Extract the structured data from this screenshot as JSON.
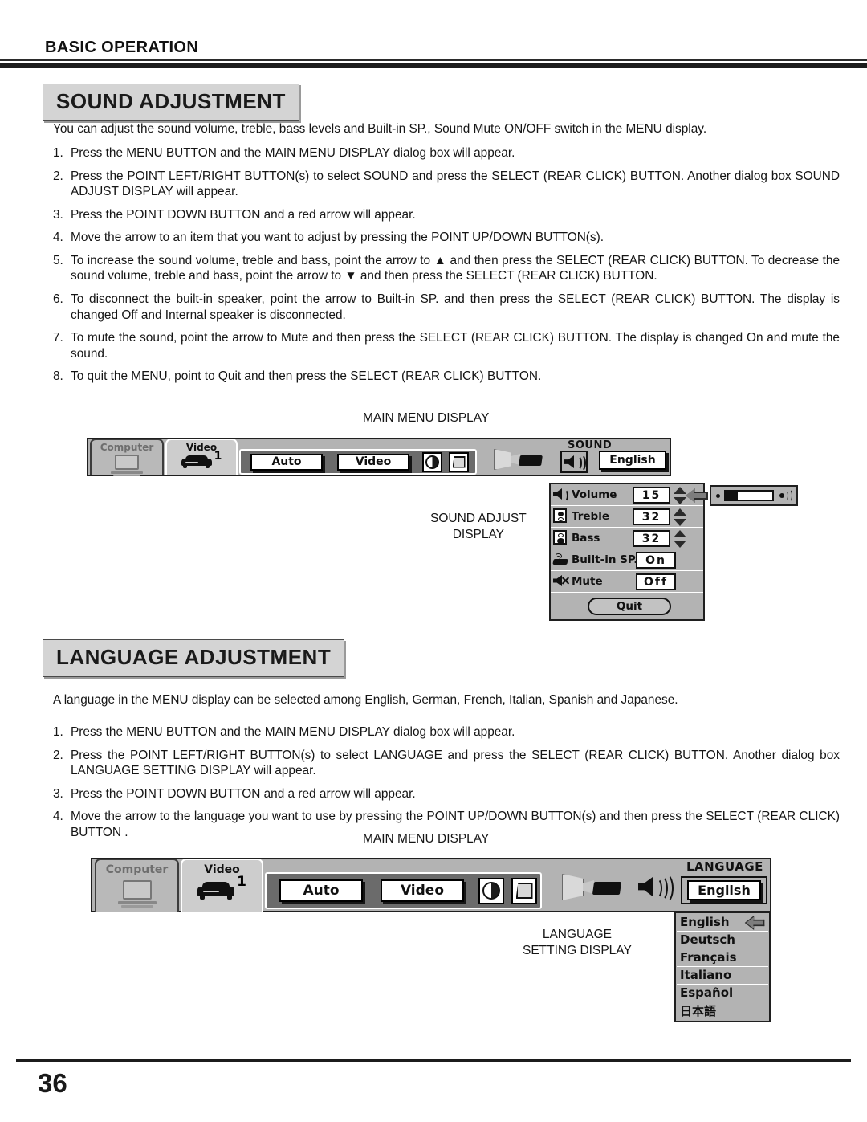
{
  "header": {
    "title": "BASIC OPERATION"
  },
  "footer": {
    "page_number": "36"
  },
  "sound_section": {
    "title": "SOUND ADJUSTMENT",
    "intro": "You can adjust the sound volume, treble, bass levels and Built-in SP., Sound Mute ON/OFF switch in the MENU display.",
    "steps": [
      {
        "num": "1.",
        "text": "Press the MENU BUTTON and the MAIN MENU DISPLAY dialog box will appear."
      },
      {
        "num": "2.",
        "text": "Press the POINT LEFT/RIGHT BUTTON(s) to select SOUND and press the SELECT (REAR CLICK) BUTTON. Another dialog box SOUND ADJUST DISPLAY will appear."
      },
      {
        "num": "3.",
        "text": "Press the POINT DOWN BUTTON and a red arrow will appear."
      },
      {
        "num": "4.",
        "text": "Move the arrow to an item that you want to adjust by pressing the POINT UP/DOWN BUTTON(s)."
      },
      {
        "num": "5.",
        "text": "To increase the sound volume, treble and bass, point the arrow to ▲ and then press the SELECT (REAR CLICK) BUTTON. To decrease the sound volume, treble and bass, point the arrow to ▼ and then press the SELECT (REAR CLICK) BUTTON."
      },
      {
        "num": "6.",
        "text": "To disconnect the built-in speaker, point the arrow to Built-in SP. and then press the SELECT (REAR CLICK) BUTTON. The display is changed Off and Internal speaker is disconnected."
      },
      {
        "num": "7.",
        "text": "To mute the sound, point the arrow to Mute and then press the SELECT (REAR CLICK) BUTTON. The display is changed On and mute the sound."
      },
      {
        "num": "8.",
        "text": "To quit the MENU, point to Quit and then press the SELECT (REAR CLICK) BUTTON."
      }
    ],
    "figure": {
      "main_menu_caption": "MAIN MENU DISPLAY",
      "dialog_caption_line1": "SOUND ADJUST",
      "dialog_caption_line2": "DISPLAY",
      "menu_bar": {
        "tab_computer": "Computer",
        "tab_video": "Video",
        "source_number": "1",
        "button_auto": "Auto",
        "button_video": "Video",
        "group_label": "SOUND",
        "language_value": "English"
      },
      "sound_dialog": {
        "rows": [
          {
            "icon": "speaker-icon",
            "label": "Volume",
            "value": "15",
            "has_spinner": true
          },
          {
            "icon": "treble-speaker-icon",
            "label": "Treble",
            "value": "32",
            "has_spinner": true
          },
          {
            "icon": "bass-speaker-icon",
            "label": "Bass",
            "value": "32",
            "has_spinner": true
          },
          {
            "icon": "builtin-speaker-icon",
            "label": "Built-in SP.",
            "value": "On",
            "has_spinner": false
          },
          {
            "icon": "mute-speaker-icon",
            "label": "Mute",
            "value": "Off",
            "has_spinner": false
          }
        ],
        "quit_label": "Quit"
      },
      "volume_popup": {
        "fill_percent": 26
      }
    }
  },
  "language_section": {
    "title": "LANGUAGE ADJUSTMENT",
    "intro": "A language in the MENU display can be selected among English, German, French, Italian, Spanish and Japanese.",
    "steps": [
      {
        "num": "1.",
        "text": "Press the MENU BUTTON and the MAIN MENU DISPLAY dialog box will appear."
      },
      {
        "num": "2.",
        "text": "Press the POINT LEFT/RIGHT BUTTON(s) to select LANGUAGE and press the SELECT (REAR CLICK) BUTTON. Another dialog box LANGUAGE SETTING DISPLAY will appear."
      },
      {
        "num": "3.",
        "text": "Press the POINT DOWN BUTTON and a red arrow will appear."
      },
      {
        "num": "4.",
        "text": "Move the arrow to the language you want to use by pressing the POINT UP/DOWN BUTTON(s) and then press the SELECT (REAR CLICK) BUTTON ."
      }
    ],
    "figure": {
      "main_menu_caption": "MAIN MENU DISPLAY",
      "dialog_caption_line1": "LANGUAGE",
      "dialog_caption_line2": "SETTING DISPLAY",
      "menu_bar": {
        "tab_computer": "Computer",
        "tab_video": "Video",
        "source_number": "1",
        "button_auto": "Auto",
        "button_video": "Video",
        "group_label": "LANGUAGE",
        "language_value": "English"
      },
      "language_list": [
        {
          "label": "English",
          "selected": true
        },
        {
          "label": "Deutsch",
          "selected": false
        },
        {
          "label": "Français",
          "selected": false
        },
        {
          "label": "Italiano",
          "selected": false
        },
        {
          "label": "Español",
          "selected": false
        },
        {
          "label": "日本語",
          "selected": false
        }
      ]
    }
  }
}
